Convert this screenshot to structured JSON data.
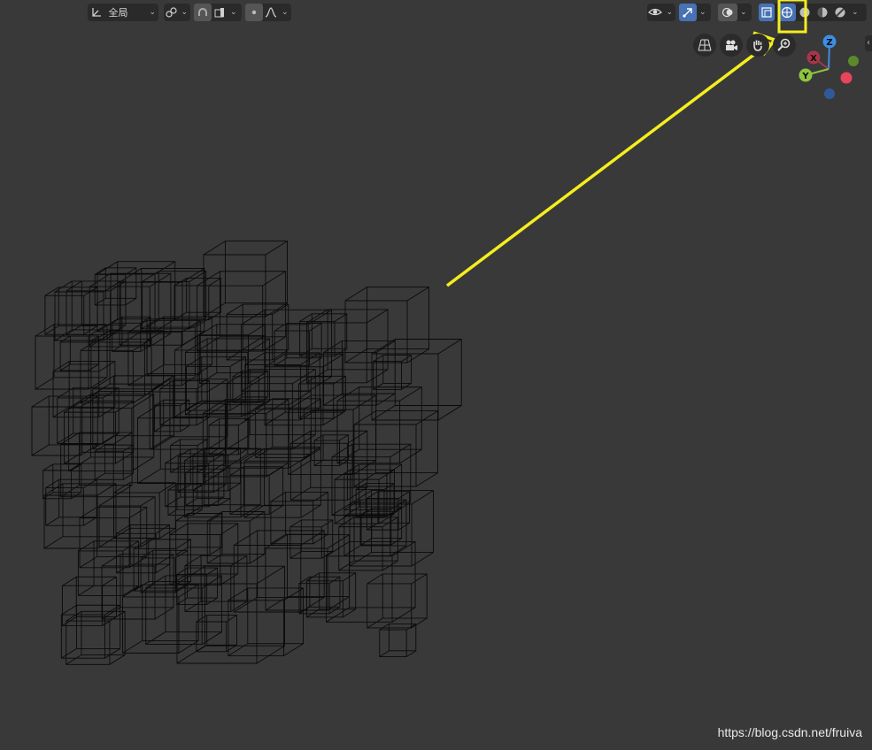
{
  "header": {
    "orientation": {
      "value": "全局",
      "icon": "transform-orientation-icon"
    },
    "pivot": {
      "icon": "pivot-point-icon"
    },
    "snap": {
      "icon": "snap-magnet-icon"
    },
    "snap_target": {
      "icon": "snap-increment-icon"
    },
    "proportional": {
      "icon": "proportional-edit-icon",
      "falloff_icon": "falloff-curve-icon"
    },
    "visibility": {
      "icon": "object-visibility-eye-icon"
    },
    "gizmos": {
      "icon": "gizmo-icon"
    },
    "overlays": {
      "icon": "overlays-icon"
    },
    "xray": {
      "icon": "xray-toggle-icon"
    },
    "shading": {
      "modes": [
        {
          "name": "Wireframe",
          "icon": "shading-wireframe-icon",
          "active": true
        },
        {
          "name": "Solid",
          "icon": "shading-solid-icon",
          "active": false
        },
        {
          "name": "Material Preview",
          "icon": "shading-material-icon",
          "active": false
        },
        {
          "name": "Rendered",
          "icon": "shading-rendered-icon",
          "active": false
        }
      ]
    }
  },
  "nav_buttons": [
    {
      "icon": "perspective-grid-icon"
    },
    {
      "icon": "camera-icon"
    },
    {
      "icon": "hand-pan-icon"
    },
    {
      "icon": "zoom-magnifier-icon"
    }
  ],
  "gizmo": {
    "x": "X",
    "y": "Y",
    "z": "Z"
  },
  "watermark": "https://blog.csdn.net/fruiva",
  "colors": {
    "background": "#393939",
    "header_button": "#2a2a2a",
    "active": "#4772b3",
    "annotation": "#f5ee1e",
    "wire": "#0a0a0a",
    "axis_x": "#e8445a",
    "axis_y": "#8cc63f",
    "axis_z": "#3b8ee6"
  }
}
